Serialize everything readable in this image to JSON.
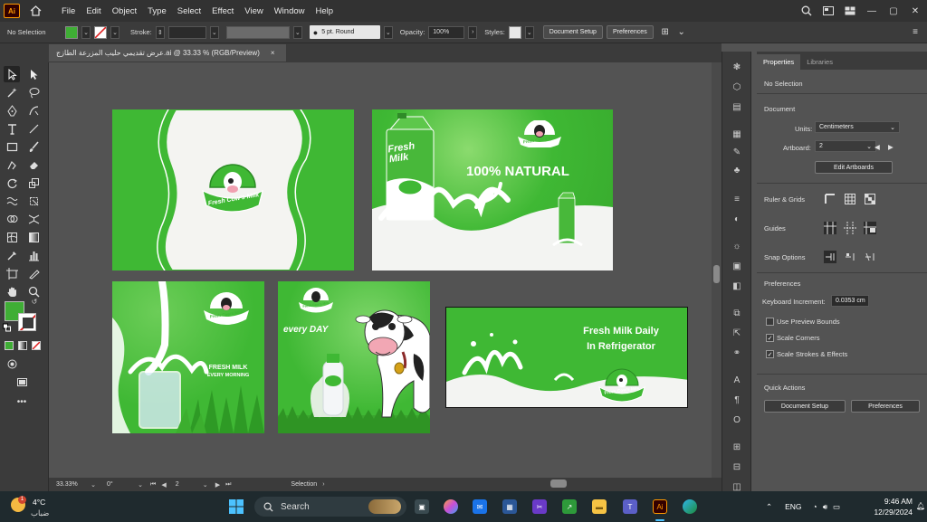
{
  "app": {
    "logo": "Ai",
    "menus": [
      "File",
      "Edit",
      "Object",
      "Type",
      "Select",
      "Effect",
      "View",
      "Window",
      "Help"
    ]
  },
  "control": {
    "selection": "No Selection",
    "stroke_label": "Stroke:",
    "brush": "5 pt. Round",
    "opacity_label": "Opacity:",
    "opacity_value": "100%",
    "styles_label": "Styles:",
    "doc_setup": "Document Setup",
    "preferences": "Preferences"
  },
  "document": {
    "tab_title": "عرض تقديمي حليب المزرعة الطازج.ai @ 33.33 % (RGB/Preview)",
    "close": "×"
  },
  "status": {
    "zoom": "33.33%",
    "rotation": "0°",
    "artboard_num": "2",
    "tool": "Selection"
  },
  "artboards": {
    "brand": "Fresh Cow's Milk",
    "pack_text": "Fresh Milk",
    "natural": "100% NATURAL",
    "fresh_milk": "FRESH MILK",
    "every_morning": "EVERY MORNING",
    "every_day": "every DAY",
    "banner_line1": "Fresh Milk Daily",
    "banner_line2": "In Refrigerator"
  },
  "panel": {
    "tabs": [
      "Properties",
      "Libraries"
    ],
    "no_selection": "No Selection",
    "document_header": "Document",
    "units_label": "Units:",
    "units_value": "Centimeters",
    "artboard_label": "Artboard:",
    "artboard_value": "2",
    "edit_artboards": "Edit Artboards",
    "rulers_grids": "Ruler & Grids",
    "guides": "Guides",
    "snap_options": "Snap Options",
    "preferences_header": "Preferences",
    "keyboard_increment_label": "Keyboard Increment:",
    "keyboard_increment_value": "0.0353 cm",
    "use_preview_bounds": "Use Preview Bounds",
    "scale_corners": "Scale Corners",
    "scale_strokes": "Scale Strokes & Effects",
    "quick_actions": "Quick Actions",
    "document_setup": "Document Setup",
    "preferences": "Preferences"
  },
  "taskbar": {
    "temperature": "4°C",
    "weather": "ضباب",
    "notification_count": "1",
    "search": "Search",
    "language": "ENG",
    "time": "9:46 AM",
    "date": "12/29/2024"
  },
  "colors": {
    "fill": "#3fae35",
    "green": "#3fb834",
    "milk": "#f3f4f2"
  }
}
